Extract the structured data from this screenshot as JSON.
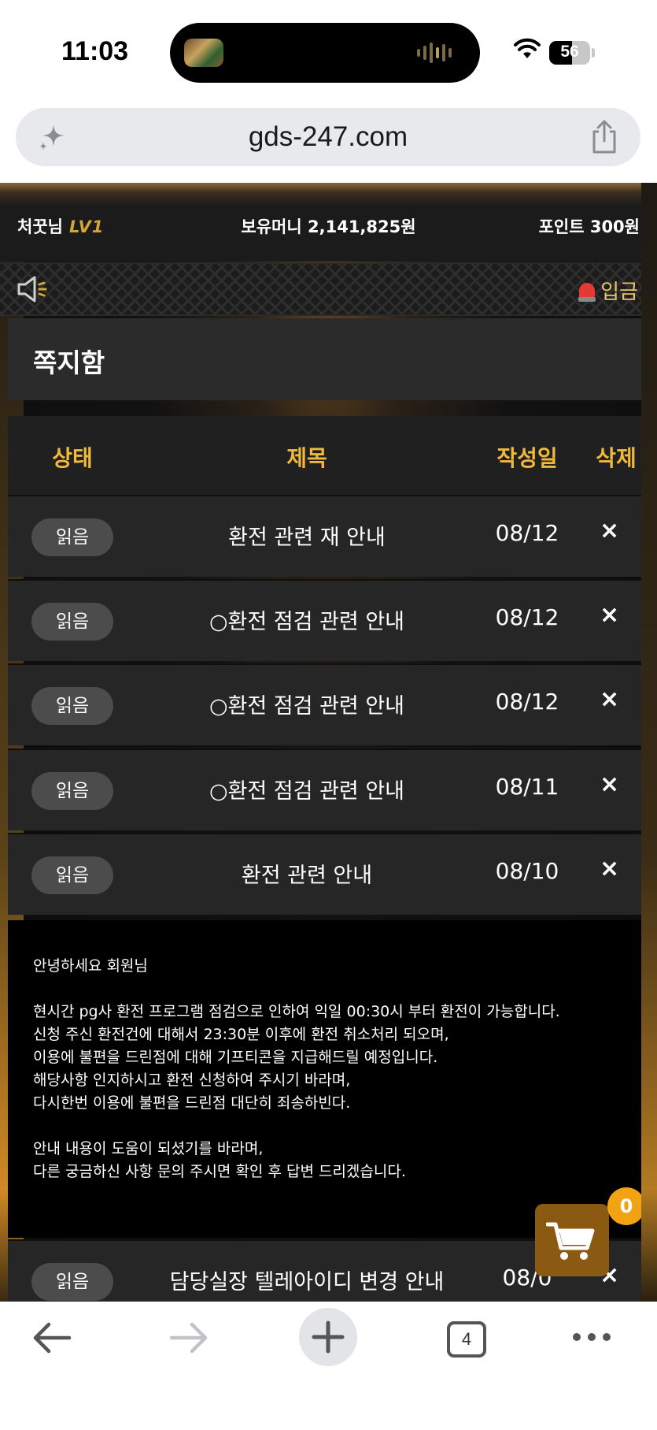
{
  "status_bar": {
    "time": "11:03",
    "battery": "56",
    "battery_level": 0.56
  },
  "browser": {
    "url": "gds-247.com",
    "tab_count": "4"
  },
  "header": {
    "user_name": "처꿋님",
    "level": "LV1",
    "money": "보유머니 2,141,825원",
    "points": "포인트 300원",
    "deposit_label": "입금"
  },
  "page": {
    "title": "쪽지함"
  },
  "table": {
    "columns": {
      "status": "상태",
      "subject": "제목",
      "date": "작성일",
      "delete": "삭제"
    },
    "delete_symbol": "×",
    "rows": [
      {
        "status": "읽음",
        "subject": "환전 관련 재 안내",
        "date": "08/12"
      },
      {
        "status": "읽음",
        "subject": "○환전 점검 관련 안내",
        "date": "08/12"
      },
      {
        "status": "읽음",
        "subject": "○환전 점검 관련 안내",
        "date": "08/12"
      },
      {
        "status": "읽음",
        "subject": "○환전 점검 관련 안내",
        "date": "08/11"
      },
      {
        "status": "읽음",
        "subject": "환전 관련 안내",
        "date": "08/10"
      },
      {
        "status": "읽음",
        "subject": "담당실장 텔레아이디 변경 안내",
        "date": "08/0"
      }
    ]
  },
  "message": {
    "body": "안녕하세요 회원님\n\n현시간 pg사 환전 프로그램 점검으로 인하여 익일 00:30시 부터 환전이 가능합니다.\n신청 주신 환전건에 대해서 23:30분 이후에 환전 취소처리 되오며,\n이용에 불편을 드린점에 대해 기프티콘을 지급해드릴 예정입니다.\n해당사항 인지하시고 환전 신청하여 주시기 바라며,\n다시한번 이용에 불편을 드린점 대단히 죄송하빈다.\n\n안내 내용이 도움이 되셨기를 바라며,\n다른 궁금하신 사항 문의 주시면 확인 후 답변 드리겠습니다."
  },
  "cart": {
    "count": "0"
  },
  "colors": {
    "accent": "#f0b93c",
    "cart": "#8a5a12",
    "badge": "#f2a314"
  }
}
